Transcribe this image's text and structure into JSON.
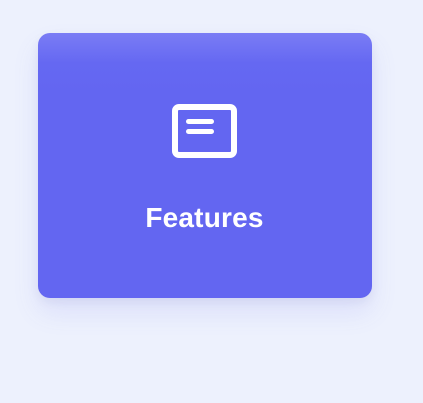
{
  "card": {
    "label": "Features",
    "icon": "window-icon",
    "background_color": "#6366f1",
    "text_color": "#ffffff"
  },
  "page": {
    "background_color": "#edf1fd"
  }
}
